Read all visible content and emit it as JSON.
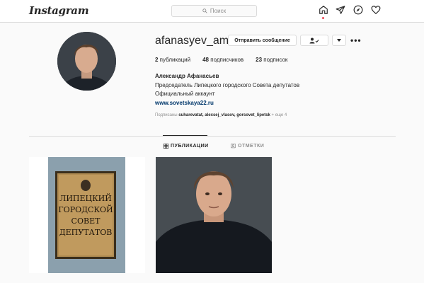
{
  "header": {
    "logo": "Instagram",
    "search_placeholder": "Поиск",
    "icons": [
      "home-icon",
      "direct-icon",
      "explore-icon",
      "activity-heart-icon"
    ]
  },
  "profile": {
    "username": "afanasyev_am",
    "message_button": "Отправить сообщение",
    "follow_button_icon": "person-check-icon",
    "dropdown_icon": "caret-down-icon",
    "options_label": "•••",
    "stats": {
      "posts_count": "2",
      "posts_label": " публикаций",
      "followers_count": "48",
      "followers_label": " подписчиков",
      "following_count": "23",
      "following_label": " подписок"
    },
    "bio": {
      "full_name": "Александр Афанасьев",
      "line1": "Председатель Липецкого городского Совета депутатов",
      "line2": "Официальный аккаунт",
      "link": "www.sovetskaya22.ru"
    },
    "followed_by": {
      "prefix": "Подписаны ",
      "users": "suharevatat, alexsej_vlasov, gorsovet_lipetsk",
      "suffix": " + еще 4"
    }
  },
  "tabs": [
    {
      "label": "ПУБЛИКАЦИИ",
      "icon": "grid-icon",
      "active": true
    },
    {
      "label": "ОТМЕТКИ",
      "icon": "tagged-icon",
      "active": false
    }
  ],
  "posts": [
    {
      "sign_lines": [
        "ЛИПЕЦКИЙ",
        "ГОРОДСКОЙ",
        "СОВЕТ",
        "ДЕПУТАТОВ"
      ]
    },
    {
      "description": "portrait photo"
    }
  ],
  "colors": {
    "background": "#fafafa",
    "border": "#dbdbdb",
    "text": "#262626",
    "muted": "#8e8e8e",
    "link": "#00376b",
    "notification": "#ed4956"
  }
}
